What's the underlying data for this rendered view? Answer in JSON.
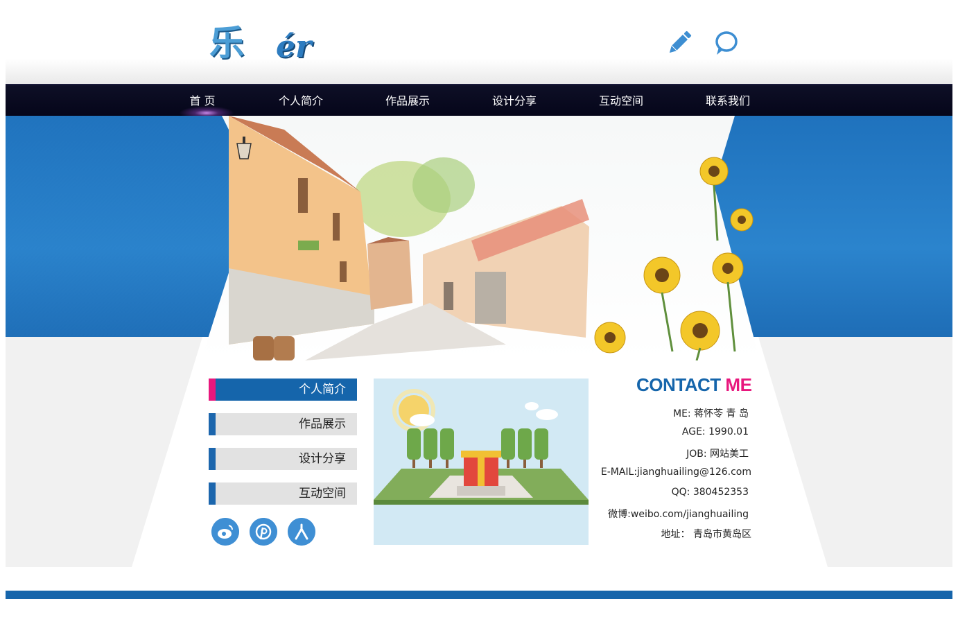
{
  "logo": {
    "main": "乐",
    "sub": "ér"
  },
  "header_icons": [
    "pencil-icon",
    "chat-bubble-icon"
  ],
  "nav": {
    "items": [
      "首  页",
      "个人简介",
      "作品展示",
      "设计分享",
      "互动空间",
      "联系我们"
    ],
    "active_index": 0
  },
  "sidebar": {
    "items": [
      "个人简介",
      "作品展示",
      "设计分享",
      "互动空间"
    ],
    "active_index": 0
  },
  "social_icons": [
    "weibo-icon",
    "pinterest-icon",
    "renren-icon"
  ],
  "contact": {
    "title_part1": "CONTACT",
    "title_part2": "ME",
    "lines": [
      "ME: 蒋怀苓 青 岛",
      "AGE: 1990.01",
      "JOB: 网站美工",
      "E-MAIL:jianghuailing@126.com",
      "QQ: 380452353",
      "微博:weibo.com/jianghuailing",
      "地址： 青岛市黄岛区"
    ]
  },
  "colors": {
    "primary_blue": "#1565ab",
    "accent_pink": "#e8177d",
    "nav_bg": "#0a0b20",
    "banner_blue": "#2579c2"
  }
}
